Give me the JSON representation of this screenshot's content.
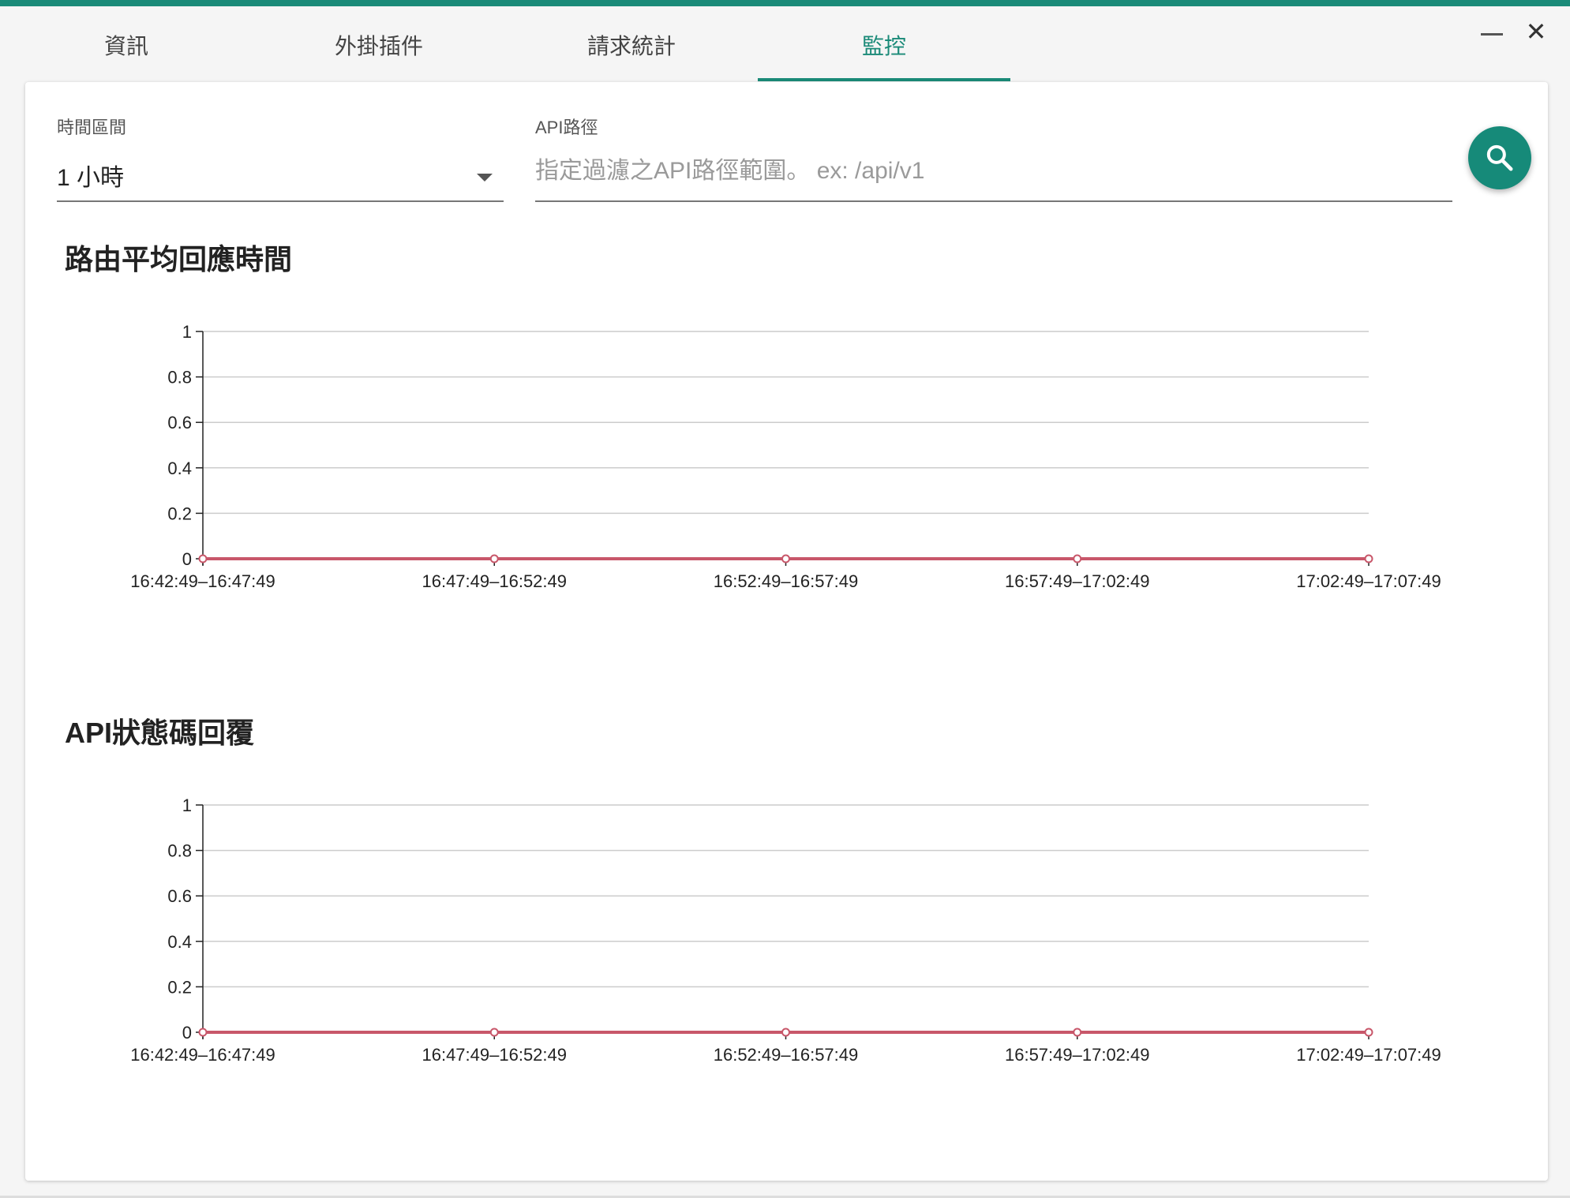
{
  "tabs": [
    {
      "label": "資訊"
    },
    {
      "label": "外掛插件"
    },
    {
      "label": "請求統計"
    },
    {
      "label": "監控",
      "active": true
    }
  ],
  "window_controls": {
    "minimize_icon": "minus-icon",
    "close_icon": "close-icon"
  },
  "filters": {
    "time_range": {
      "label": "時間區間",
      "value": "1 小時"
    },
    "api_path": {
      "label": "API路徑",
      "placeholder": "指定過濾之API路徑範圍。 ex: /api/v1",
      "value": ""
    },
    "search_icon": "search-icon"
  },
  "colors": {
    "accent": "#1a8a78",
    "series": "#c8576a",
    "grid": "#cccccc"
  },
  "chart_data": [
    {
      "type": "line",
      "title": "路由平均回應時間",
      "x": [
        "16:42:49–16:47:49",
        "16:47:49–16:52:49",
        "16:52:49–16:57:49",
        "16:57:49–17:02:49",
        "17:02:49–17:07:49"
      ],
      "y_ticks": [
        "0",
        "0.2",
        "0.4",
        "0.6",
        "0.8",
        "1"
      ],
      "ylim": [
        0,
        1
      ],
      "grid": true,
      "series": [
        {
          "values": [
            0,
            0,
            0,
            0,
            0
          ]
        }
      ]
    },
    {
      "type": "line",
      "title": "API狀態碼回覆",
      "x": [
        "16:42:49–16:47:49",
        "16:47:49–16:52:49",
        "16:52:49–16:57:49",
        "16:57:49–17:02:49",
        "17:02:49–17:07:49"
      ],
      "y_ticks": [
        "0",
        "0.2",
        "0.4",
        "0.6",
        "0.8",
        "1"
      ],
      "ylim": [
        0,
        1
      ],
      "grid": true,
      "series": [
        {
          "values": [
            0,
            0,
            0,
            0,
            0
          ]
        }
      ]
    }
  ]
}
